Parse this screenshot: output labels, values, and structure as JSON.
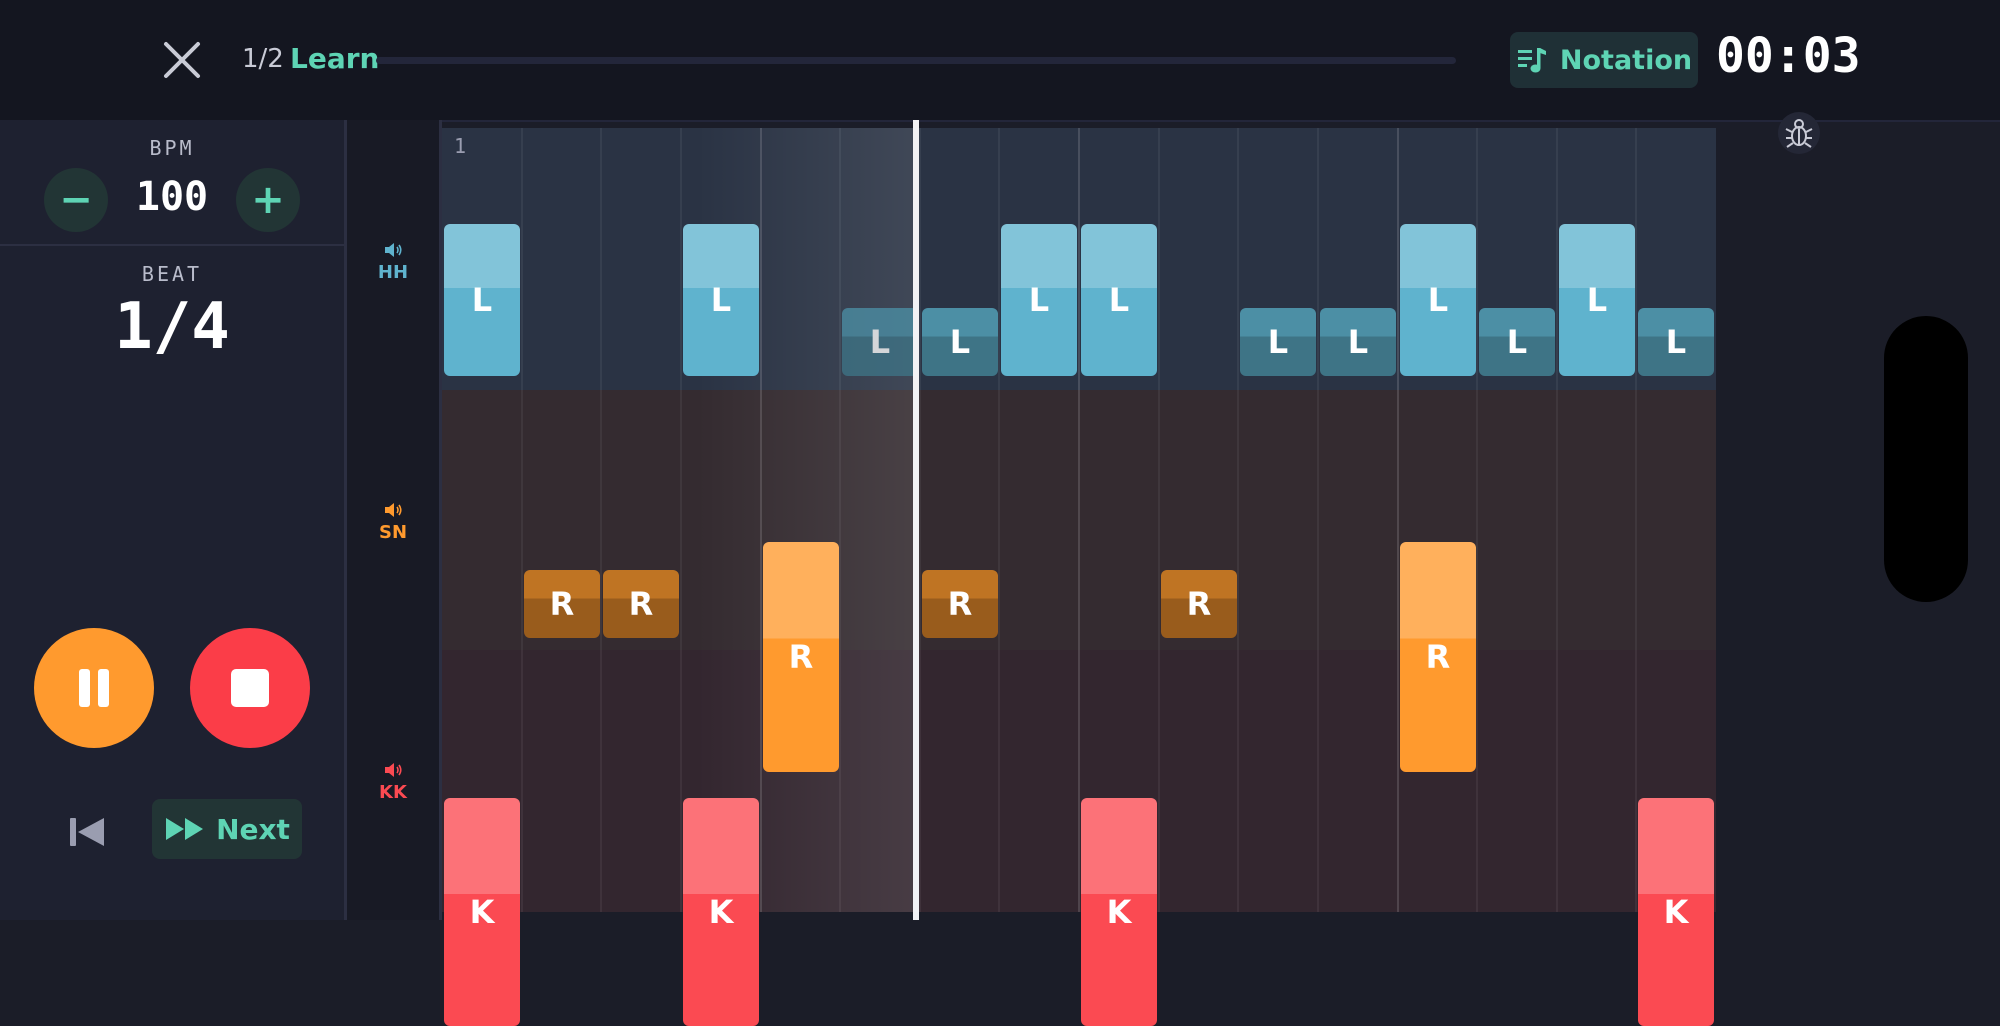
{
  "header": {
    "progress_count": "1/2",
    "progress_label": "Learn",
    "notation_label": "Notation",
    "timer": "00:03"
  },
  "controls": {
    "bpm_label": "BPM",
    "bpm_value": "100",
    "minus_symbol": "−",
    "plus_symbol": "+",
    "beat_label": "BEAT",
    "beat_value": "1/4",
    "next_label": "Next"
  },
  "sequencer": {
    "bar_number": "1",
    "steps": 16,
    "playhead_step": 5.95,
    "tracks": [
      {
        "name": "HH",
        "color": "#5fb3ce"
      },
      {
        "name": "SN",
        "color": "#ff9a2e"
      },
      {
        "name": "KK",
        "color": "#fb4a52"
      }
    ],
    "notes": [
      {
        "track": 0,
        "step": 0,
        "label": "L",
        "accent": true
      },
      {
        "track": 0,
        "step": 3,
        "label": "L",
        "accent": true
      },
      {
        "track": 0,
        "step": 5,
        "label": "L",
        "accent": false
      },
      {
        "track": 0,
        "step": 6,
        "label": "L",
        "accent": false
      },
      {
        "track": 0,
        "step": 7,
        "label": "L",
        "accent": true
      },
      {
        "track": 0,
        "step": 8,
        "label": "L",
        "accent": true
      },
      {
        "track": 0,
        "step": 10,
        "label": "L",
        "accent": false
      },
      {
        "track": 0,
        "step": 11,
        "label": "L",
        "accent": false
      },
      {
        "track": 0,
        "step": 12,
        "label": "L",
        "accent": true
      },
      {
        "track": 0,
        "step": 13,
        "label": "L",
        "accent": false
      },
      {
        "track": 0,
        "step": 14,
        "label": "L",
        "accent": true
      },
      {
        "track": 0,
        "step": 15,
        "label": "L",
        "accent": false
      },
      {
        "track": 1,
        "step": 1,
        "label": "R",
        "accent": false
      },
      {
        "track": 1,
        "step": 2,
        "label": "R",
        "accent": false
      },
      {
        "track": 1,
        "step": 4,
        "label": "R",
        "accent": true
      },
      {
        "track": 1,
        "step": 6,
        "label": "R",
        "accent": false
      },
      {
        "track": 1,
        "step": 9,
        "label": "R",
        "accent": false
      },
      {
        "track": 1,
        "step": 12,
        "label": "R",
        "accent": true
      },
      {
        "track": 2,
        "step": 0,
        "label": "K",
        "accent": true
      },
      {
        "track": 2,
        "step": 3,
        "label": "K",
        "accent": true
      },
      {
        "track": 2,
        "step": 8,
        "label": "K",
        "accent": true
      },
      {
        "track": 2,
        "step": 15,
        "label": "K",
        "accent": true
      }
    ]
  },
  "colors": {
    "accent": "#5ed4b4",
    "pause": "#ff9a2e",
    "stop": "#fb3d48"
  },
  "icons": {
    "close": "close-icon",
    "notation": "notation-icon",
    "pause": "pause-icon",
    "stop": "stop-icon",
    "previous": "skip-previous-icon",
    "next": "fast-forward-icon",
    "speaker": "speaker-icon",
    "bug": "bug-icon"
  }
}
